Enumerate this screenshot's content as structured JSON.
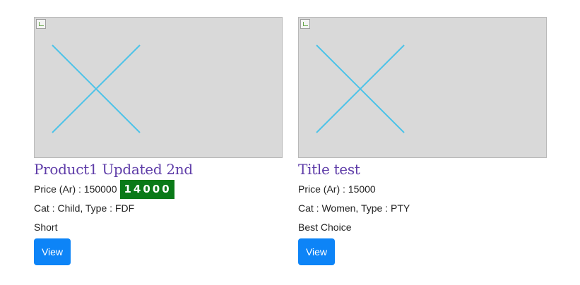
{
  "products": [
    {
      "title": "Product1 Updated 2nd",
      "price_label": "Price (Ar) : 150000",
      "discount_price": "14000",
      "category_line": "Cat : Child, Type : FDF",
      "tag": "Short",
      "button_label": "View"
    },
    {
      "title": "Title test",
      "price_label": "Price (Ar) : 15000",
      "category_line": "Cat : Women, Type : PTY",
      "tag": "Best Choice",
      "button_label": "View"
    }
  ],
  "colors": {
    "title": "#5e3ca8",
    "discount_badge": "#0a7a18",
    "button": "#0d84f7",
    "placeholder_bg": "#d9d9d9",
    "placeholder_cross": "#4cc3e8"
  },
  "icons": {
    "image_placeholder": "broken-image-icon"
  }
}
